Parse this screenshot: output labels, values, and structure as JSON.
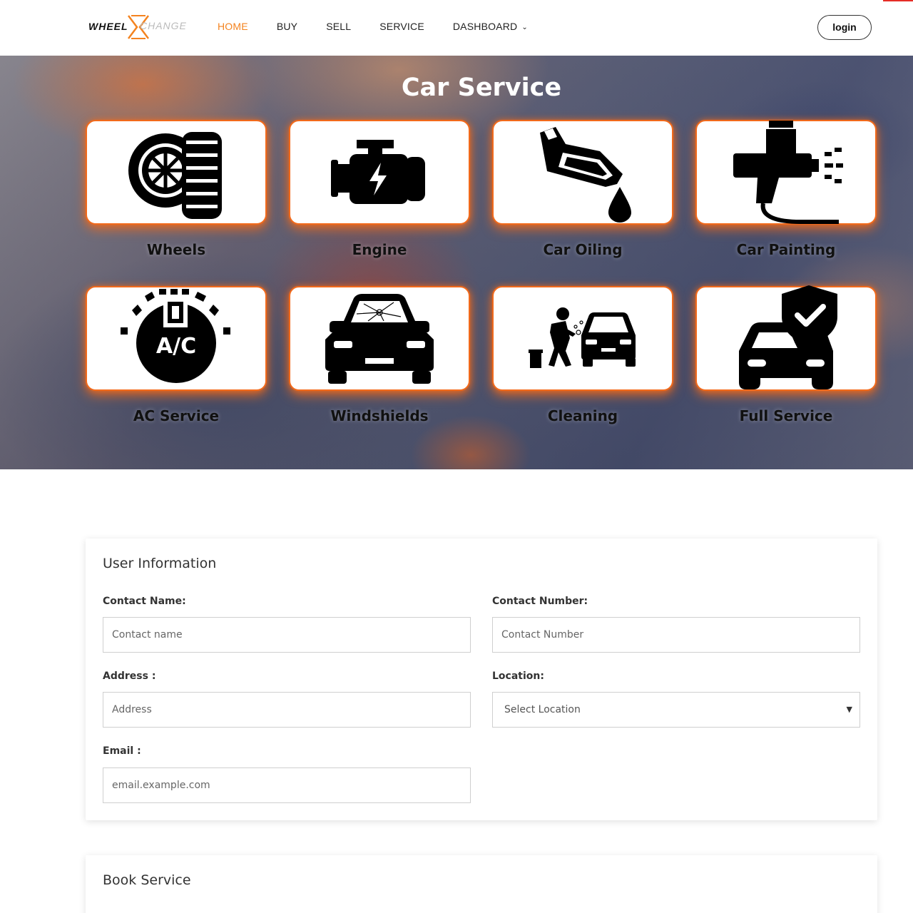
{
  "header": {
    "logo": {
      "part1": "WHEEL",
      "part2": "CHANGE",
      "x_color": "#f4831f"
    },
    "nav": [
      {
        "label": "HOME",
        "active": true
      },
      {
        "label": "BUY",
        "active": false
      },
      {
        "label": "SELL",
        "active": false
      },
      {
        "label": "SERVICE",
        "active": false
      },
      {
        "label": "DASHBOARD",
        "active": false,
        "has_dropdown": true
      }
    ],
    "login_label": "login"
  },
  "hero": {
    "title": "Car Service",
    "services": [
      {
        "label": "Wheels",
        "icon": "wheel-tire-icon"
      },
      {
        "label": "Engine",
        "icon": "engine-icon"
      },
      {
        "label": "Car Oiling",
        "icon": "oil-can-icon"
      },
      {
        "label": "Car Painting",
        "icon": "spray-gun-icon"
      },
      {
        "label": "AC Service",
        "icon": "ac-icon"
      },
      {
        "label": "Windshields",
        "icon": "cracked-windshield-icon"
      },
      {
        "label": "Cleaning",
        "icon": "car-wash-icon"
      },
      {
        "label": "Full Service",
        "icon": "car-shield-icon"
      }
    ],
    "accent": "#f26a1b"
  },
  "user_info": {
    "title": "User Information",
    "contact_name": {
      "label": "Contact Name:",
      "placeholder": "Contact name"
    },
    "contact_number": {
      "label": "Contact Number:",
      "placeholder": "Contact Number"
    },
    "address": {
      "label": "Address :",
      "placeholder": "Address"
    },
    "location": {
      "label": "Location:",
      "value": "Select Location"
    },
    "email": {
      "label": "Email :",
      "placeholder": "email.example.com"
    }
  },
  "book_service": {
    "title": "Book Service"
  }
}
